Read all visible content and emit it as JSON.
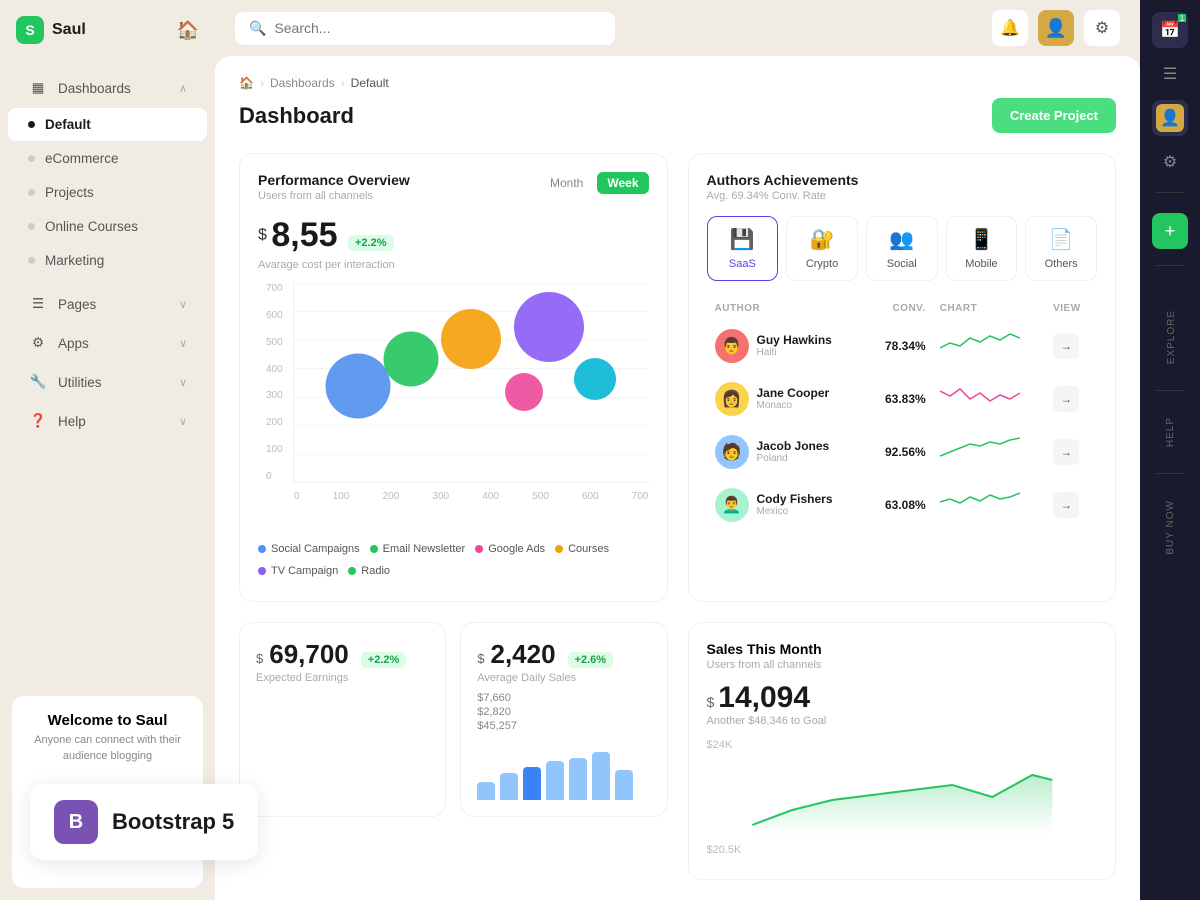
{
  "app": {
    "name": "Saul",
    "logo_letter": "S"
  },
  "sidebar": {
    "nav_items": [
      {
        "id": "dashboards",
        "label": "Dashboards",
        "has_chevron": true,
        "has_icon": true,
        "icon": "▦",
        "active": false
      },
      {
        "id": "default",
        "label": "Default",
        "has_dot": true,
        "active": true
      },
      {
        "id": "ecommerce",
        "label": "eCommerce",
        "has_dot": true,
        "active": false
      },
      {
        "id": "projects",
        "label": "Projects",
        "has_dot": true,
        "active": false
      },
      {
        "id": "online-courses",
        "label": "Online Courses",
        "has_dot": true,
        "active": false
      },
      {
        "id": "marketing",
        "label": "Marketing",
        "has_dot": true,
        "active": false
      },
      {
        "id": "pages",
        "label": "Pages",
        "has_icon": true,
        "icon": "☰",
        "has_chevron": true,
        "active": false
      },
      {
        "id": "apps",
        "label": "Apps",
        "has_icon": true,
        "icon": "⚙",
        "has_chevron": true,
        "active": false
      },
      {
        "id": "utilities",
        "label": "Utilities",
        "has_icon": true,
        "icon": "🔧",
        "has_chevron": true,
        "active": false
      },
      {
        "id": "help",
        "label": "Help",
        "has_icon": true,
        "icon": "?",
        "has_chevron": true,
        "active": false
      }
    ],
    "footer": {
      "title": "Welcome to Saul",
      "subtitle": "Anyone can connect with their audience blogging"
    }
  },
  "topbar": {
    "search_placeholder": "Search...",
    "search_value": ""
  },
  "breadcrumb": {
    "home": "🏠",
    "dashboards": "Dashboards",
    "current": "Default"
  },
  "page": {
    "title": "Dashboard",
    "create_btn": "Create Project"
  },
  "performance": {
    "title": "Performance Overview",
    "subtitle": "Users from all channels",
    "time_tabs": [
      "Month",
      "Week"
    ],
    "active_tab": "Month",
    "metric_value": "8,55",
    "metric_currency": "$",
    "metric_badge": "+2.2%",
    "metric_label": "Avarage cost per interaction",
    "y_labels": [
      "700",
      "600",
      "500",
      "400",
      "300",
      "200",
      "100",
      "0"
    ],
    "x_labels": [
      "0",
      "100",
      "200",
      "300",
      "400",
      "500",
      "600",
      "700"
    ],
    "bubbles": [
      {
        "x": 18,
        "y": 52,
        "size": 65,
        "color": "#4f90f0"
      },
      {
        "x": 33,
        "y": 38,
        "size": 55,
        "color": "#22c55e"
      },
      {
        "x": 50,
        "y": 28,
        "size": 60,
        "color": "#f59e0b"
      },
      {
        "x": 65,
        "y": 22,
        "size": 38,
        "color": "#ec4899"
      },
      {
        "x": 72,
        "y": 45,
        "size": 70,
        "color": "#8b5cf6"
      },
      {
        "x": 85,
        "y": 50,
        "size": 42,
        "color": "#06b6d4"
      }
    ],
    "legend": [
      {
        "label": "Social Campaigns",
        "color": "#4f90f0"
      },
      {
        "label": "Email Newsletter",
        "color": "#22c55e"
      },
      {
        "label": "Google Ads",
        "color": "#ec4899"
      },
      {
        "label": "Courses",
        "color": "#f59e0b"
      },
      {
        "label": "TV Campaign",
        "color": "#8b5cf6"
      },
      {
        "label": "Radio",
        "color": "#22c55e"
      }
    ]
  },
  "authors": {
    "title": "Authors Achievements",
    "subtitle": "Avg. 69.34% Conv. Rate",
    "tabs": [
      {
        "id": "saas",
        "label": "SaaS",
        "icon": "💾",
        "active": true
      },
      {
        "id": "crypto",
        "label": "Crypto",
        "icon": "🔐",
        "active": false
      },
      {
        "id": "social",
        "label": "Social",
        "icon": "👥",
        "active": false
      },
      {
        "id": "mobile",
        "label": "Mobile",
        "icon": "📱",
        "active": false
      },
      {
        "id": "others",
        "label": "Others",
        "icon": "📄",
        "active": false
      }
    ],
    "columns": [
      "AUTHOR",
      "CONV.",
      "CHART",
      "VIEW"
    ],
    "rows": [
      {
        "name": "Guy Hawkins",
        "country": "Haiti",
        "conv": "78.34%",
        "spark_color": "#22c55e",
        "avatar": "👨"
      },
      {
        "name": "Jane Cooper",
        "country": "Monaco",
        "conv": "63.83%",
        "spark_color": "#ec4899",
        "avatar": "👩"
      },
      {
        "name": "Jacob Jones",
        "country": "Poland",
        "conv": "92.56%",
        "spark_color": "#22c55e",
        "avatar": "🧑"
      },
      {
        "name": "Cody Fishers",
        "country": "Mexico",
        "conv": "63.08%",
        "spark_color": "#22c55e",
        "avatar": "👨‍🦱"
      }
    ]
  },
  "earnings": {
    "currency": "$",
    "value": "69,700",
    "badge": "+2.2%",
    "label": "Expected Earnings"
  },
  "daily_sales": {
    "currency": "$",
    "value": "2,420",
    "badge": "+2.6%",
    "label": "Average Daily Sales",
    "bars": [
      7660,
      2820,
      45257
    ],
    "bar_values": [
      "$7,660",
      "$2,820",
      "$45,257"
    ]
  },
  "sales_month": {
    "title": "Sales This Month",
    "subtitle": "Users from all channels",
    "currency": "$",
    "value": "14,094",
    "goal_note": "Another $48,346 to Goal",
    "y_labels": [
      "$24K",
      "$20.5K"
    ],
    "bars": [
      40,
      55,
      65,
      70,
      75,
      80,
      50
    ]
  },
  "right_panel": {
    "buttons": [
      "📅",
      "☰",
      "👤",
      "⚙"
    ],
    "sections": [
      {
        "label": "Explore",
        "icon": "→"
      },
      {
        "label": "Help",
        "icon": "?"
      },
      {
        "label": "Buy now",
        "icon": "$"
      }
    ]
  },
  "bootstrap_badge": {
    "letter": "B",
    "text": "Bootstrap 5"
  }
}
